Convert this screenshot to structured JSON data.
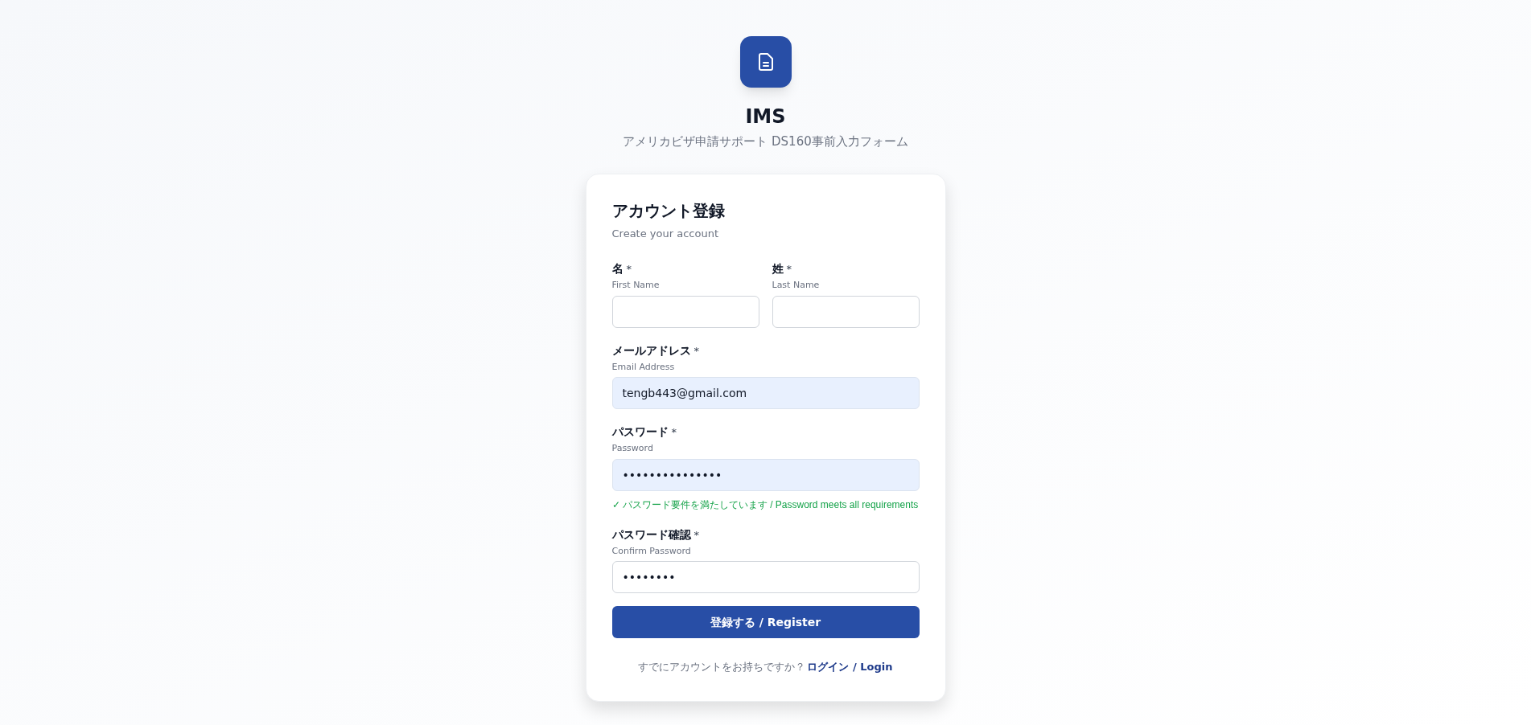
{
  "app": {
    "name": "IMS",
    "subtitle": "アメリカビザ申請サポート DS160事前入力フォーム"
  },
  "card": {
    "title": "アカウント登録",
    "subtitle": "Create your account",
    "name_fields": [
      {
        "label": "名",
        "required_mark": "*",
        "sublabel": "First Name",
        "autofilled": false
      },
      {
        "label": "姓",
        "required_mark": "*",
        "sublabel": "Last Name",
        "autofilled": false
      }
    ],
    "fields": [
      {
        "label": "メールアドレス",
        "required_mark": "*",
        "sublabel": "Email Address",
        "value": "tengb443@gmail.com",
        "autofilled": true
      },
      {
        "label": "パスワード",
        "required_mark": "*",
        "sublabel": "Password",
        "value": "•••••••••••••••",
        "autofilled": true,
        "hint": "✓ パスワード要件を満たしています / Password meets all requirements"
      },
      {
        "label": "パスワード確認",
        "required_mark": "*",
        "sublabel": "Confirm Password",
        "value": "••••••••",
        "autofilled": false
      }
    ],
    "submit": "登録する / Register",
    "footer_text": "すでにアカウントをお持ちですか？",
    "login_link": "ログイン / Login"
  }
}
